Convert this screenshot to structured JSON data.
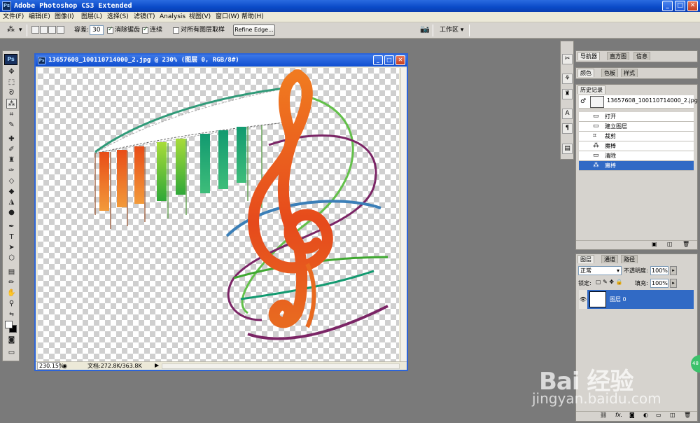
{
  "app": {
    "title": "Adobe Photoshop CS3 Extended",
    "icon_text": "Ps"
  },
  "window_buttons": {
    "minimize": "_",
    "maximize": "□",
    "close": "✕"
  },
  "menu": [
    "文件(F)",
    "编辑(E)",
    "图像(I)",
    "图层(L)",
    "选择(S)",
    "滤镜(T)",
    "Analysis",
    "视图(V)",
    "窗口(W)",
    "帮助(H)"
  ],
  "options": {
    "tolerance_label": "容差:",
    "tolerance_value": "30",
    "antialias_label": "消除锯齿",
    "antialias_checked": true,
    "contiguous_label": "连续",
    "contiguous_checked": true,
    "sample_all_label": "对所有图层取样",
    "sample_all_checked": false,
    "refine_edge": "Refine Edge...",
    "workspace": "工作区 ▾"
  },
  "toolbox": {
    "logo": "Ps"
  },
  "document": {
    "title": "13657608_100110714000_2.jpg @ 230% (图层 0, RGB/8#)",
    "zoom": "230.15%",
    "doc_info": "文档:272.8K/363.8K"
  },
  "panels": {
    "navigator_tabs": [
      "导航器",
      "直方图",
      "信息"
    ],
    "color_tabs": [
      "颜色",
      "色板",
      "样式"
    ],
    "history_tab": "历史记录",
    "history_snapshot": "13657608_100110714000_2.jpg",
    "history_items": [
      {
        "label": "打开",
        "icon": "document-icon"
      },
      {
        "label": "建立图层",
        "icon": "document-icon"
      },
      {
        "label": "裁剪",
        "icon": "crop-icon"
      },
      {
        "label": "魔棒",
        "icon": "magic-wand-icon"
      },
      {
        "label": "清除",
        "icon": "document-icon"
      },
      {
        "label": "魔棒",
        "icon": "magic-wand-icon",
        "selected": true
      }
    ],
    "layers_tabs": [
      "图层",
      "通道",
      "路径"
    ],
    "blend_mode": "正常",
    "opacity_label": "不透明度:",
    "opacity_value": "100%",
    "lock_label": "锁定:",
    "fill_label": "填充:",
    "fill_value": "100%",
    "layer_name": "图层 0"
  },
  "watermark": {
    "logo": "Bai 经验",
    "url": "jingyan.baidu.com",
    "badge": "48"
  },
  "colors": {
    "title_bar": "#0a4ac8",
    "selection": "#316ac5",
    "workspace": "#7a7a7a"
  }
}
